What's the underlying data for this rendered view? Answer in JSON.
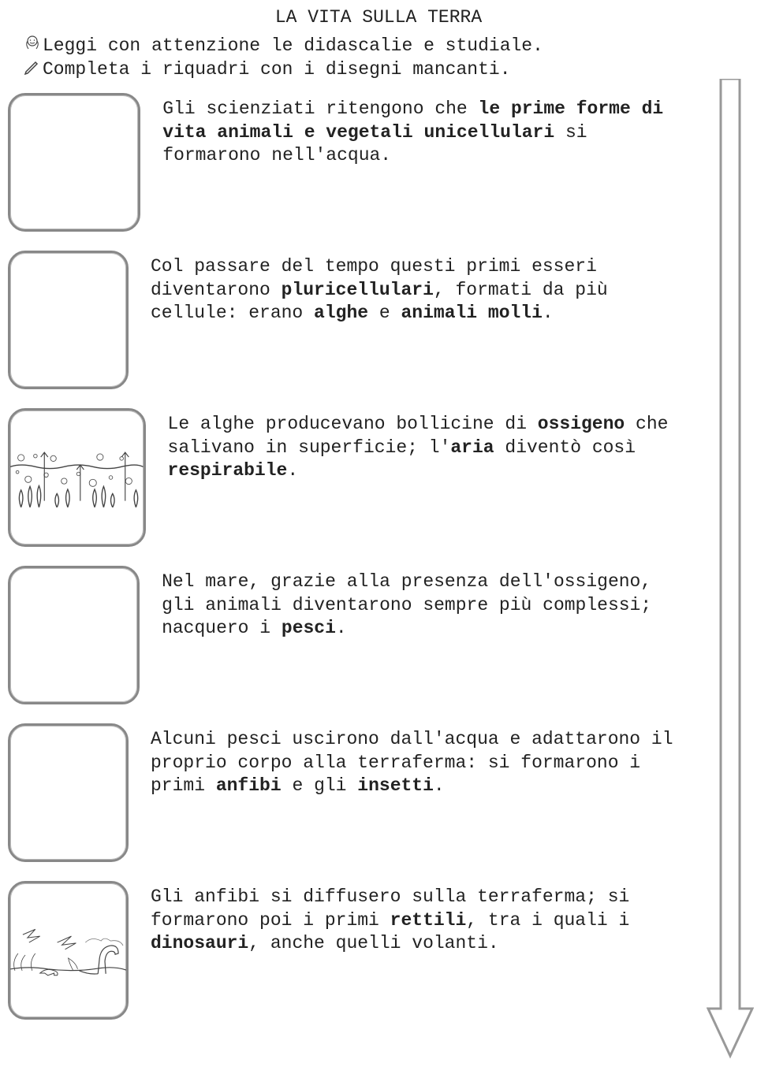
{
  "title": "LA VITA SULLA TERRA",
  "instructions": {
    "read_icon_name": "face-icon",
    "read_text": "Leggi con attenzione le didascalie e studiale.",
    "draw_icon_name": "pencil-icon",
    "draw_text": "Completa i riquadri con i disegni mancanti."
  },
  "captions": {
    "c1": {
      "t1": "Gli scienziati ritengono che ",
      "b1": "le prime forme di vita animali e vegetali unicellulari",
      "t2": " si formarono nell'acqua."
    },
    "c2": {
      "t1": "Col passare del tempo questi primi esseri diventarono ",
      "b1": "pluricellulari",
      "t2": ", formati da più cellule: erano ",
      "b2": "alghe",
      "t3": " e ",
      "b3": "animali molli",
      "t4": "."
    },
    "c3": {
      "t1": "Le alghe producevano bollicine di ",
      "b1": "ossigeno",
      "t2": " che salivano in superficie; l'",
      "b2": "aria",
      "t3": " diventò così ",
      "b3": "respirabile",
      "t4": "."
    },
    "c4": {
      "t1": "Nel mare, grazie alla presenza dell'ossigeno, gli animali diventarono sempre più complessi; nacquero i ",
      "b1": "pesci",
      "t2": "."
    },
    "c5": {
      "t1": "Alcuni pesci uscirono dall'acqua e adattarono il proprio corpo alla terraferma: si formarono i primi ",
      "b1": "anfibi",
      "t2": " e gli ",
      "b2": "insetti",
      "t3": "."
    },
    "c6": {
      "t1": "Gli anfibi si diffusero sulla terraferma; si formarono poi i primi ",
      "b1": "rettili",
      "t2": ", tra i quali i ",
      "b2": "dinosauri",
      "t3": ", anche quelli volanti."
    }
  }
}
